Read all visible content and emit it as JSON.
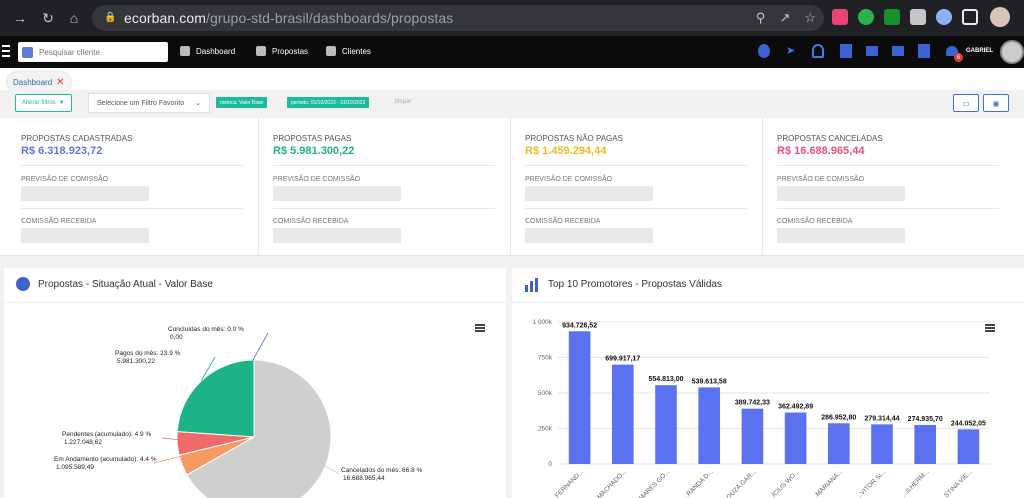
{
  "browser": {
    "url_host": "ecorban.com",
    "url_path": "/grupo-std-brasil/dashboards/propostas"
  },
  "header": {
    "search_placeholder": "Pesquisar cliente",
    "nav": [
      "Dashboard",
      "Propostas",
      "Clientes"
    ],
    "user_name": "GABRIEL",
    "notification_count": "6"
  },
  "tabs": [
    {
      "label": "Dashboard"
    }
  ],
  "filters": {
    "alter_label": "Alterar filtros",
    "favorite_placeholder": "Selecione um Filtro Favorito",
    "chips": [
      "métrica: Valor Base",
      "período: 01/10/2023 - 31/10/2023"
    ],
    "clear_label": "limpar"
  },
  "summary": [
    {
      "title": "PROPOSTAS CADASTRADAS",
      "amount": "R$ 6.318.923,72",
      "color": "#6176d6",
      "forecast_label": "PREVISÃO DE COMISSÃO",
      "received_label": "COMISSÃO RECEBIDA"
    },
    {
      "title": "PROPOSTAS PAGAS",
      "amount": "R$ 5.981.300,22",
      "color": "#1db386",
      "forecast_label": "PREVISÃO DE COMISSÃO",
      "received_label": "COMISSÃO RECEBIDA"
    },
    {
      "title": "PROPOSTAS NÃO PAGAS",
      "amount": "R$ 1.459.294,44",
      "color": "#f5b820",
      "forecast_label": "PREVISÃO DE COMISSÃO",
      "received_label": "COMISSÃO RECEBIDA"
    },
    {
      "title": "PROPOSTAS CANCELADAS",
      "amount": "R$ 16.688.965,44",
      "color": "#e8517a",
      "forecast_label": "PREVISÃO DE COMISSÃO",
      "received_label": "COMISSÃO RECEBIDA"
    }
  ],
  "panels": {
    "pie_title": "Propostas - Situação Atual - Valor Base",
    "bar_title": "Top 10 Promotores - Propostas Válidas"
  },
  "chart_data": [
    {
      "type": "pie",
      "slices": [
        {
          "label": "Concluídas do mês",
          "percent": "0.0 %",
          "value": "0,00",
          "share": 0.0,
          "color": "#4a6fd0"
        },
        {
          "label": "Pagos do mês",
          "percent": "23.9 %",
          "value": "5.981.300,22",
          "share": 23.9,
          "color": "#1db386"
        },
        {
          "label": "Pendentes (acumulado)",
          "percent": "4.9 %",
          "value": "1.227.048,62",
          "share": 4.9,
          "color": "#f06a6a"
        },
        {
          "label": "Em Andamento (acumulado)",
          "percent": "4.4 %",
          "value": "1.095.589,49",
          "share": 4.4,
          "color": "#f59a62"
        },
        {
          "label": "Cancelados do mês",
          "percent": "66.8 %",
          "value": "16.688.965,44",
          "share": 66.8,
          "color": "#cfcfcf"
        }
      ]
    },
    {
      "type": "bar",
      "categories": [
        "...FERNAND...",
        "...MACHADO...",
        "...MARES GO...",
        "...RANDA D...",
        "...OUZA GAR...",
        "...ÍCIUS WO...",
        "...MARIANA...",
        "...VITOR SI...",
        "...ILHERM...",
        "...STINA VIE..."
      ],
      "values": [
        934726.52,
        699917.17,
        554813.0,
        539613.58,
        389742.33,
        362492.89,
        286952.8,
        279314.44,
        274935.7,
        244052.05
      ],
      "value_labels": [
        "934.726,52",
        "699.917,17",
        "554.813,00",
        "539.613,58",
        "389.742,33",
        "362.492,89",
        "286.952,80",
        "279.314,44",
        "274.935,70",
        "244.052,05"
      ],
      "y_ticks": [
        "0",
        "250k",
        "500k",
        "750k",
        "1 000k"
      ],
      "ylim": [
        0,
        1000000
      ],
      "color": "#5b72f0"
    }
  ]
}
